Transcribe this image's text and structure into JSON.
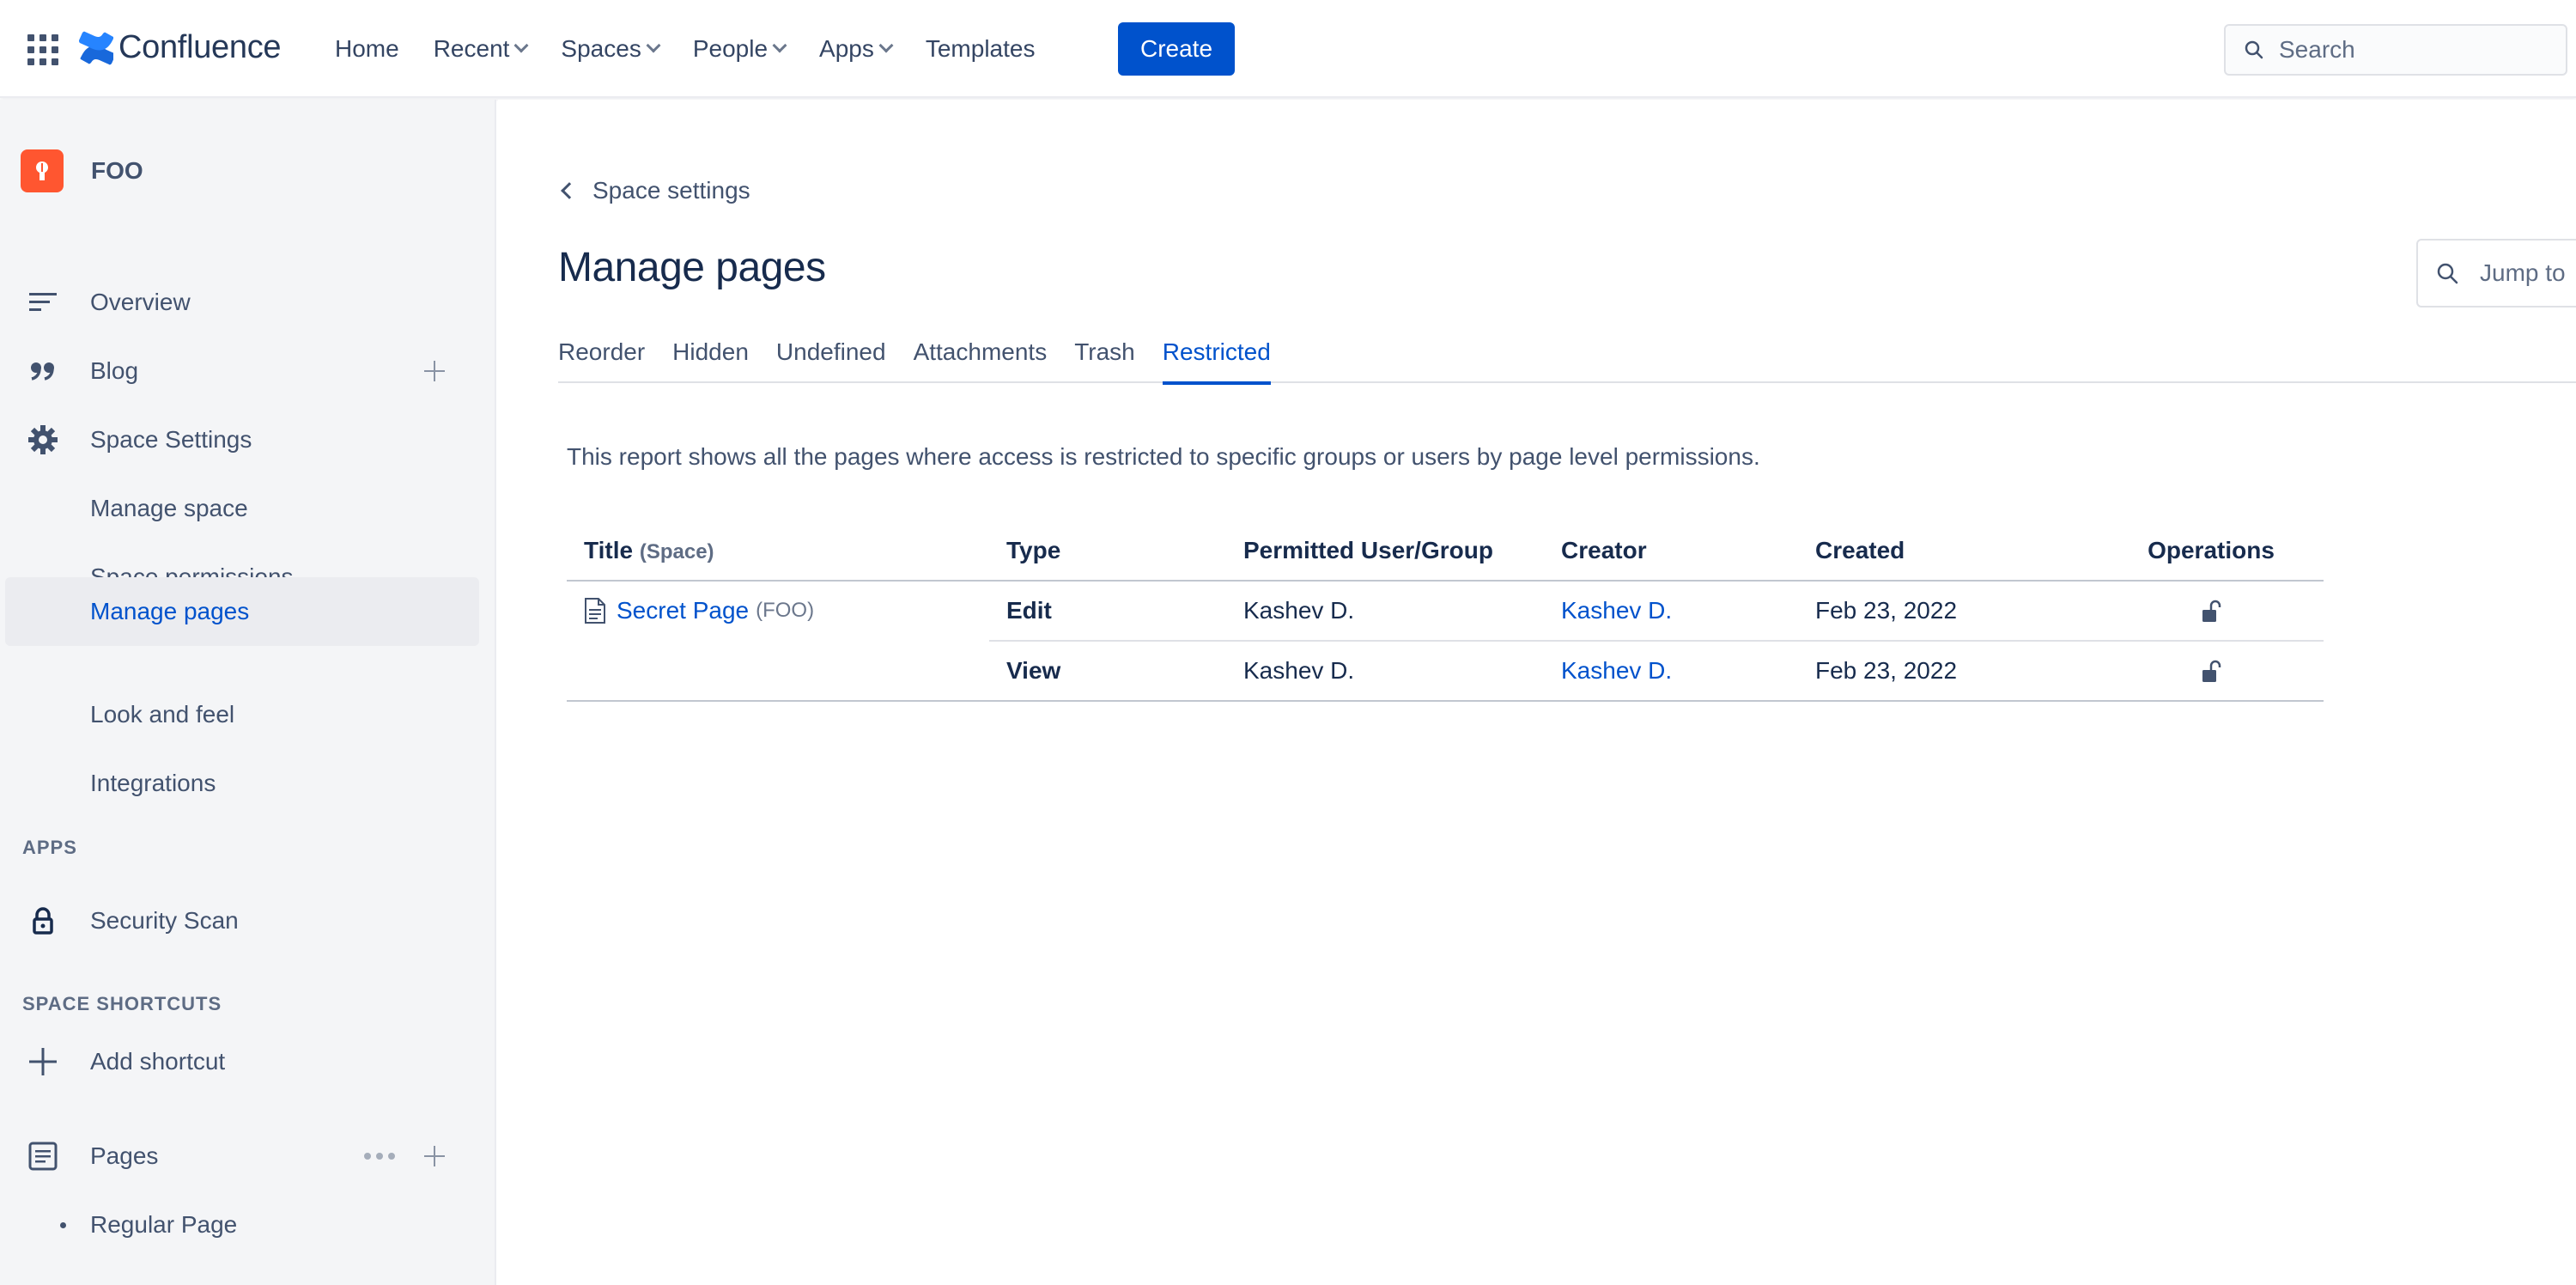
{
  "topnav": {
    "app_name": "Confluence",
    "items": [
      {
        "label": "Home",
        "dropdown": false
      },
      {
        "label": "Recent",
        "dropdown": true
      },
      {
        "label": "Spaces",
        "dropdown": true
      },
      {
        "label": "People",
        "dropdown": true
      },
      {
        "label": "Apps",
        "dropdown": true
      },
      {
        "label": "Templates",
        "dropdown": false
      }
    ],
    "create_label": "Create",
    "search_placeholder": "Search",
    "brand_color": "#0052cc"
  },
  "sidebar": {
    "space_name": "FOO",
    "items": [
      {
        "label": "Overview",
        "icon": "overview-icon"
      },
      {
        "label": "Blog",
        "icon": "quote-icon"
      },
      {
        "label": "Space Settings",
        "icon": "gear-icon"
      },
      {
        "label": "Manage space"
      },
      {
        "label": "Space permissions"
      },
      {
        "label": "Manage pages",
        "active": true
      },
      {
        "label": "Look and feel"
      },
      {
        "label": "Integrations"
      }
    ],
    "apps_label": "APPS",
    "apps_items": [
      {
        "label": "Security Scan",
        "icon": "lock-icon"
      }
    ],
    "shortcuts_label": "SPACE SHORTCUTS",
    "add_shortcut_label": "Add shortcut",
    "pages_label": "Pages",
    "pages_items": [
      {
        "label": "Regular Page"
      }
    ]
  },
  "main": {
    "back_label": "Space settings",
    "title": "Manage pages",
    "jump_placeholder": "Jump to",
    "tabs": [
      {
        "label": "Reorder"
      },
      {
        "label": "Hidden"
      },
      {
        "label": "Undefined"
      },
      {
        "label": "Attachments"
      },
      {
        "label": "Trash"
      },
      {
        "label": "Restricted",
        "active": true
      }
    ],
    "report_text": "This report shows all the pages where access is restricted to specific groups or users by page level permissions.",
    "table": {
      "headers": {
        "title": "Title",
        "title_sub": "(Space)",
        "type": "Type",
        "permitted": "Permitted User/Group",
        "creator": "Creator",
        "created": "Created",
        "operations": "Operations"
      },
      "page_title": "Secret Page",
      "page_space": "(FOO)",
      "rows": [
        {
          "type": "Edit",
          "permitted": "Kashev D.",
          "creator": "Kashev D.",
          "created": "Feb 23, 2022"
        },
        {
          "type": "View",
          "permitted": "Kashev D.",
          "creator": "Kashev D.",
          "created": "Feb 23, 2022"
        }
      ]
    }
  }
}
